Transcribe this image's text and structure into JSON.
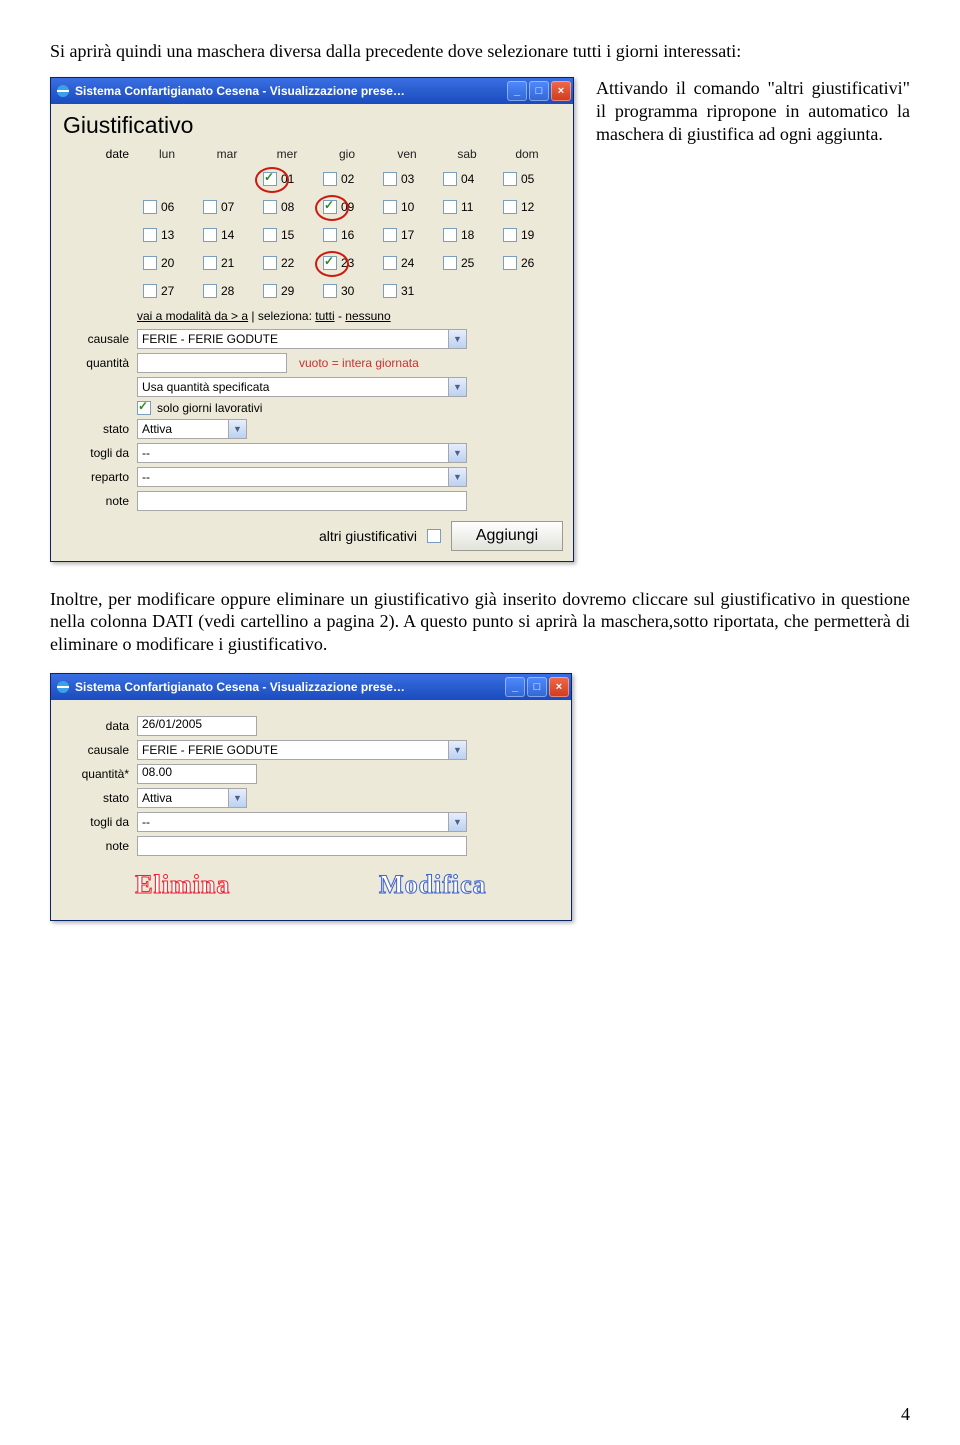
{
  "intro": "Si aprirà quindi una maschera diversa dalla precedente dove selezionare tutti i giorni interessati:",
  "side_text": "Attivando il comando \"altri giustificativi\" il programma ripropone in automatico la maschera di giustifica ad ogni aggiunta.",
  "middle_para": "Inoltre, per modificare oppure eliminare un giustificativo già inserito dovremo cliccare sul giustificativo in questione nella colonna DATI (vedi cartellino a pagina 2). A questo punto si aprirà la maschera,sotto riportata, che permetterà di eliminare o modificare i giustificativo.",
  "page_number": "4",
  "window1": {
    "title": "Sistema Confartigianato Cesena - Visualizzazione prese…",
    "heading": "Giustificativo",
    "labels": {
      "date": "date",
      "causale": "causale",
      "quantita": "quantità",
      "stato": "stato",
      "togli_da": "togli da",
      "reparto": "reparto",
      "note": "note"
    },
    "weekdays": [
      "lun",
      "mar",
      "mer",
      "gio",
      "ven",
      "sab",
      "dom"
    ],
    "days": [
      [
        null,
        null,
        "01",
        "02",
        "03",
        "04",
        "05"
      ],
      [
        "06",
        "07",
        "08",
        "09",
        "10",
        "11",
        "12"
      ],
      [
        "13",
        "14",
        "15",
        "16",
        "17",
        "18",
        "19"
      ],
      [
        "20",
        "21",
        "22",
        "23",
        "24",
        "25",
        "26"
      ],
      [
        "27",
        "28",
        "29",
        "30",
        "31",
        null,
        null
      ]
    ],
    "checked_days": [
      "01",
      "09",
      "23"
    ],
    "circled_days": [
      "01",
      "09",
      "23"
    ],
    "link_row": {
      "modalita": "vai a modalità da > a",
      "sep": " | ",
      "seleziona": "seleziona:",
      "tutti": "tutti",
      "dash": " - ",
      "nessuno": "nessuno"
    },
    "causale_value": "FERIE - FERIE GODUTE",
    "quantita_value": "",
    "quantita_hint": "vuoto = intera giornata",
    "quantita_mode": "Usa quantità specificata",
    "solo_lav_label": "solo giorni lavorativi",
    "solo_lav_checked": true,
    "stato_value": "Attiva",
    "togli_da_value": "--",
    "reparto_value": "--",
    "note_value": "",
    "altri_label": "altri giustificativi",
    "altri_checked": false,
    "aggiungi_label": "Aggiungi"
  },
  "window2": {
    "title": "Sistema Confartigianato Cesena - Visualizzazione prese…",
    "labels": {
      "data": "data",
      "causale": "causale",
      "quantita": "quantità*",
      "stato": "stato",
      "togli_da": "togli da",
      "note": "note"
    },
    "data_value": "26/01/2005",
    "causale_value": "FERIE - FERIE GODUTE",
    "quantita_value": "08.00",
    "stato_value": "Attiva",
    "togli_da_value": "--",
    "note_value": "",
    "elimina_label": "Elimina",
    "modifica_label": "Modifica"
  }
}
